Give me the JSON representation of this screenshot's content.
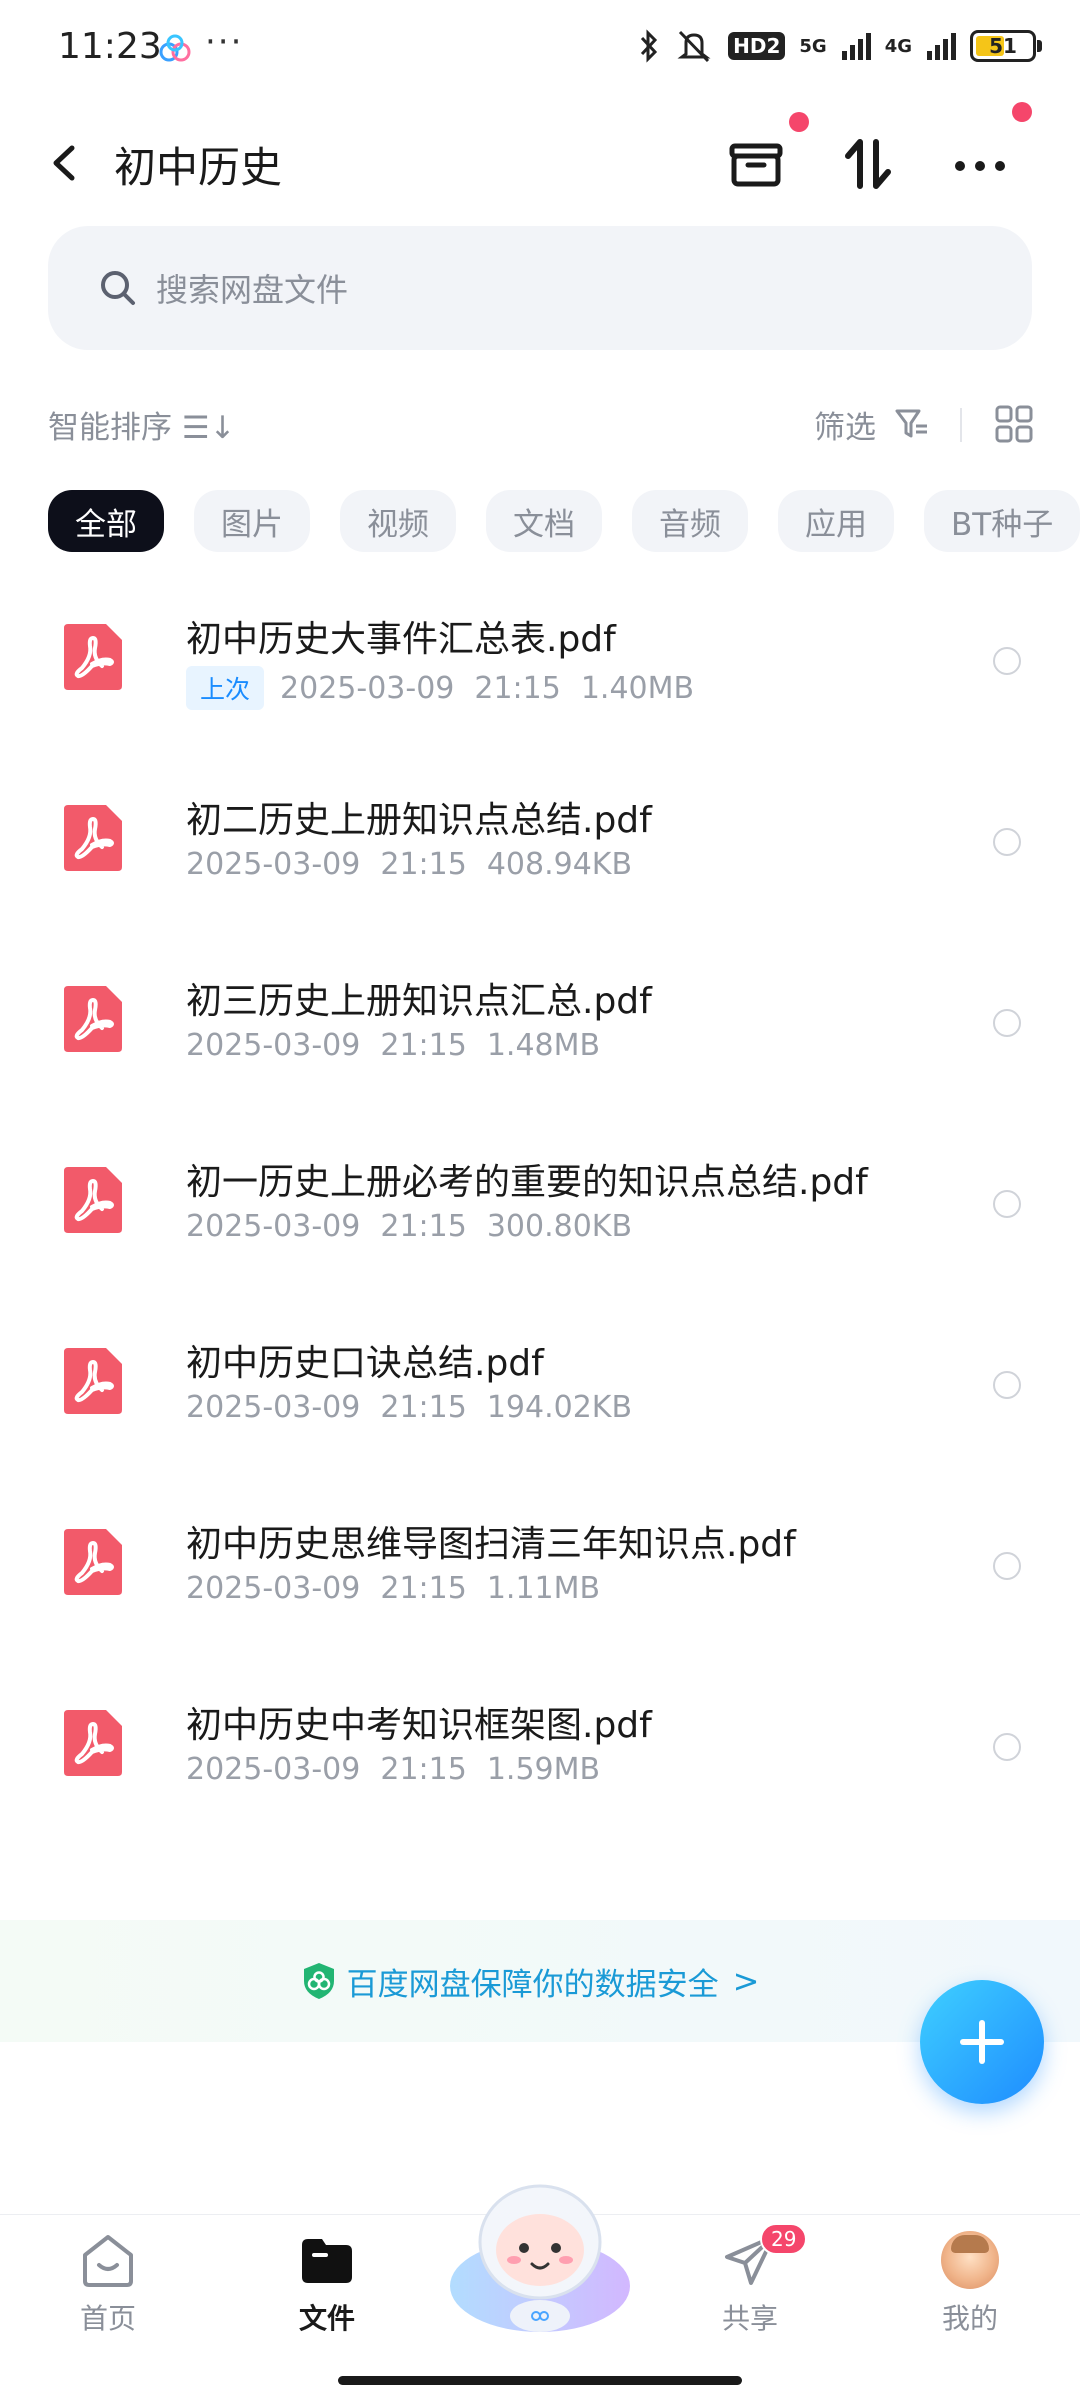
{
  "status_bar": {
    "time": "11:23",
    "dots": "···",
    "hd": "HD2",
    "net1": "5G",
    "net2": "4G",
    "battery": "51",
    "battery_level": 0.51
  },
  "header": {
    "title": "初中历史"
  },
  "search": {
    "placeholder": "搜索网盘文件"
  },
  "sort": {
    "sort_label": "智能排序 ☰↓",
    "filter_label": "筛选"
  },
  "chips": [
    "全部",
    "图片",
    "视频",
    "文档",
    "音频",
    "应用",
    "BT种子"
  ],
  "files": [
    {
      "name": "初中历史大事件汇总表.pdf",
      "tag": "上次",
      "date": "2025-03-09",
      "time": "21:15",
      "size": "1.40MB"
    },
    {
      "name": "初二历史上册知识点总结.pdf",
      "tag": "",
      "date": "2025-03-09",
      "time": "21:15",
      "size": "408.94KB"
    },
    {
      "name": "初三历史上册知识点汇总.pdf",
      "tag": "",
      "date": "2025-03-09",
      "time": "21:15",
      "size": "1.48MB"
    },
    {
      "name": "初一历史上册必考的重要的知识点总结.pdf",
      "tag": "",
      "date": "2025-03-09",
      "time": "21:15",
      "size": "300.80KB"
    },
    {
      "name": "初中历史口诀总结.pdf",
      "tag": "",
      "date": "2025-03-09",
      "time": "21:15",
      "size": "194.02KB"
    },
    {
      "name": "初中历史思维导图扫清三年知识点.pdf",
      "tag": "",
      "date": "2025-03-09",
      "time": "21:15",
      "size": "1.11MB"
    },
    {
      "name": "初中历史中考知识框架图.pdf",
      "tag": "",
      "date": "2025-03-09",
      "time": "21:15",
      "size": "1.59MB"
    }
  ],
  "banner": {
    "text": "百度网盘保障你的数据安全",
    "chevron": ">"
  },
  "bottom_nav": {
    "home": "首页",
    "files": "文件",
    "share": "共享",
    "share_badge": "29",
    "mine": "我的"
  },
  "colors": {
    "accent": "#1e8cff",
    "pdf_red": "#f25a6a",
    "badge": "#f5466b",
    "active_chip": "#0d0f1a"
  }
}
